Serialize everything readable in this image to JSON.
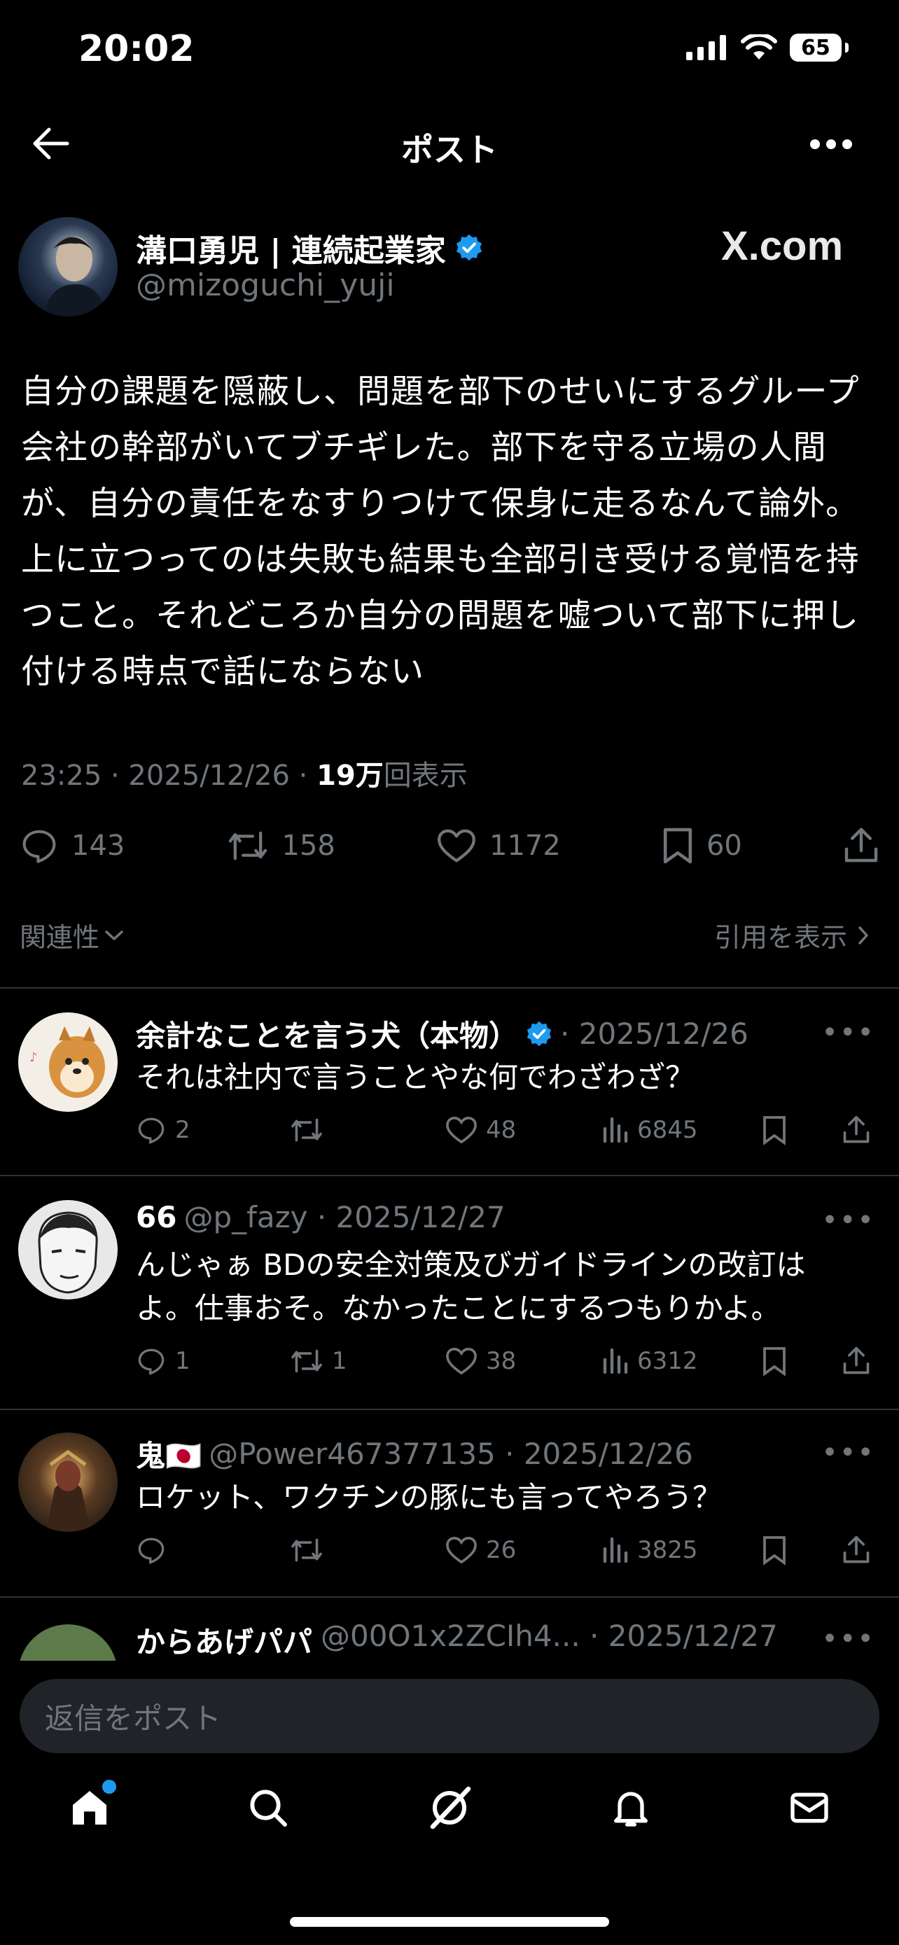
{
  "status": {
    "time": "20:02",
    "battery": "65"
  },
  "header": {
    "title": "ポスト"
  },
  "post": {
    "author_name": "溝口勇児 | 連続起業家",
    "author_handle": "@mizoguchi_yuji",
    "watermark": "X.com",
    "body": "自分の課題を隠蔽し、問題を部下のせいにするグループ会社の幹部がいてブチギレた。部下を守る立場の人間が、自分の責任をなすりつけて保身に走るなんて論外。上に立つってのは失敗も結果も全部引き受ける覚悟を持つこと。それどころか自分の問題を嘘ついて部下に押し付ける時点で話にならない",
    "timestamp": "23:25 · 2025/12/26 · ",
    "views_number": "19万",
    "views_suffix": "回表示",
    "counts": {
      "replies": "143",
      "reposts": "158",
      "likes": "1172",
      "bookmarks": "60"
    }
  },
  "sort": {
    "label": "関連性",
    "quotes_label": "引用を表示"
  },
  "replies": [
    {
      "name": "余計なことを言う犬（本物）",
      "sub": "· 2025/12/26",
      "text": "それは社内で言うことやな何でわざわざ？",
      "replies": "2",
      "reposts": "",
      "likes": "48",
      "views": "6845"
    },
    {
      "name": "66",
      "sub": "@p_fazy · 2025/12/27",
      "text": "んじゃぁ BDの安全対策及びガイドラインの改訂はよ。仕事おそ。なかったことにするつもりかよ。",
      "replies": "1",
      "reposts": "1",
      "likes": "38",
      "views": "6312"
    },
    {
      "name": "鬼🇯🇵",
      "sub": "@Power467377135 · 2025/12/26",
      "text": "ロケット、ワクチンの豚にも言ってやろう？",
      "replies": "",
      "reposts": "",
      "likes": "26",
      "views": "3825"
    },
    {
      "name": "からあげパパ",
      "sub": "@00O1x2ZCIh4... · 2025/12/27",
      "text": "",
      "replies": "",
      "reposts": "",
      "likes": "",
      "views": ""
    }
  ],
  "compose": {
    "placeholder": "返信をポスト"
  },
  "colors": {
    "background": "#000000",
    "text": "#e7e9ea",
    "muted": "#71767b",
    "verified": "#1d9bf0",
    "divider": "#2f3336"
  }
}
